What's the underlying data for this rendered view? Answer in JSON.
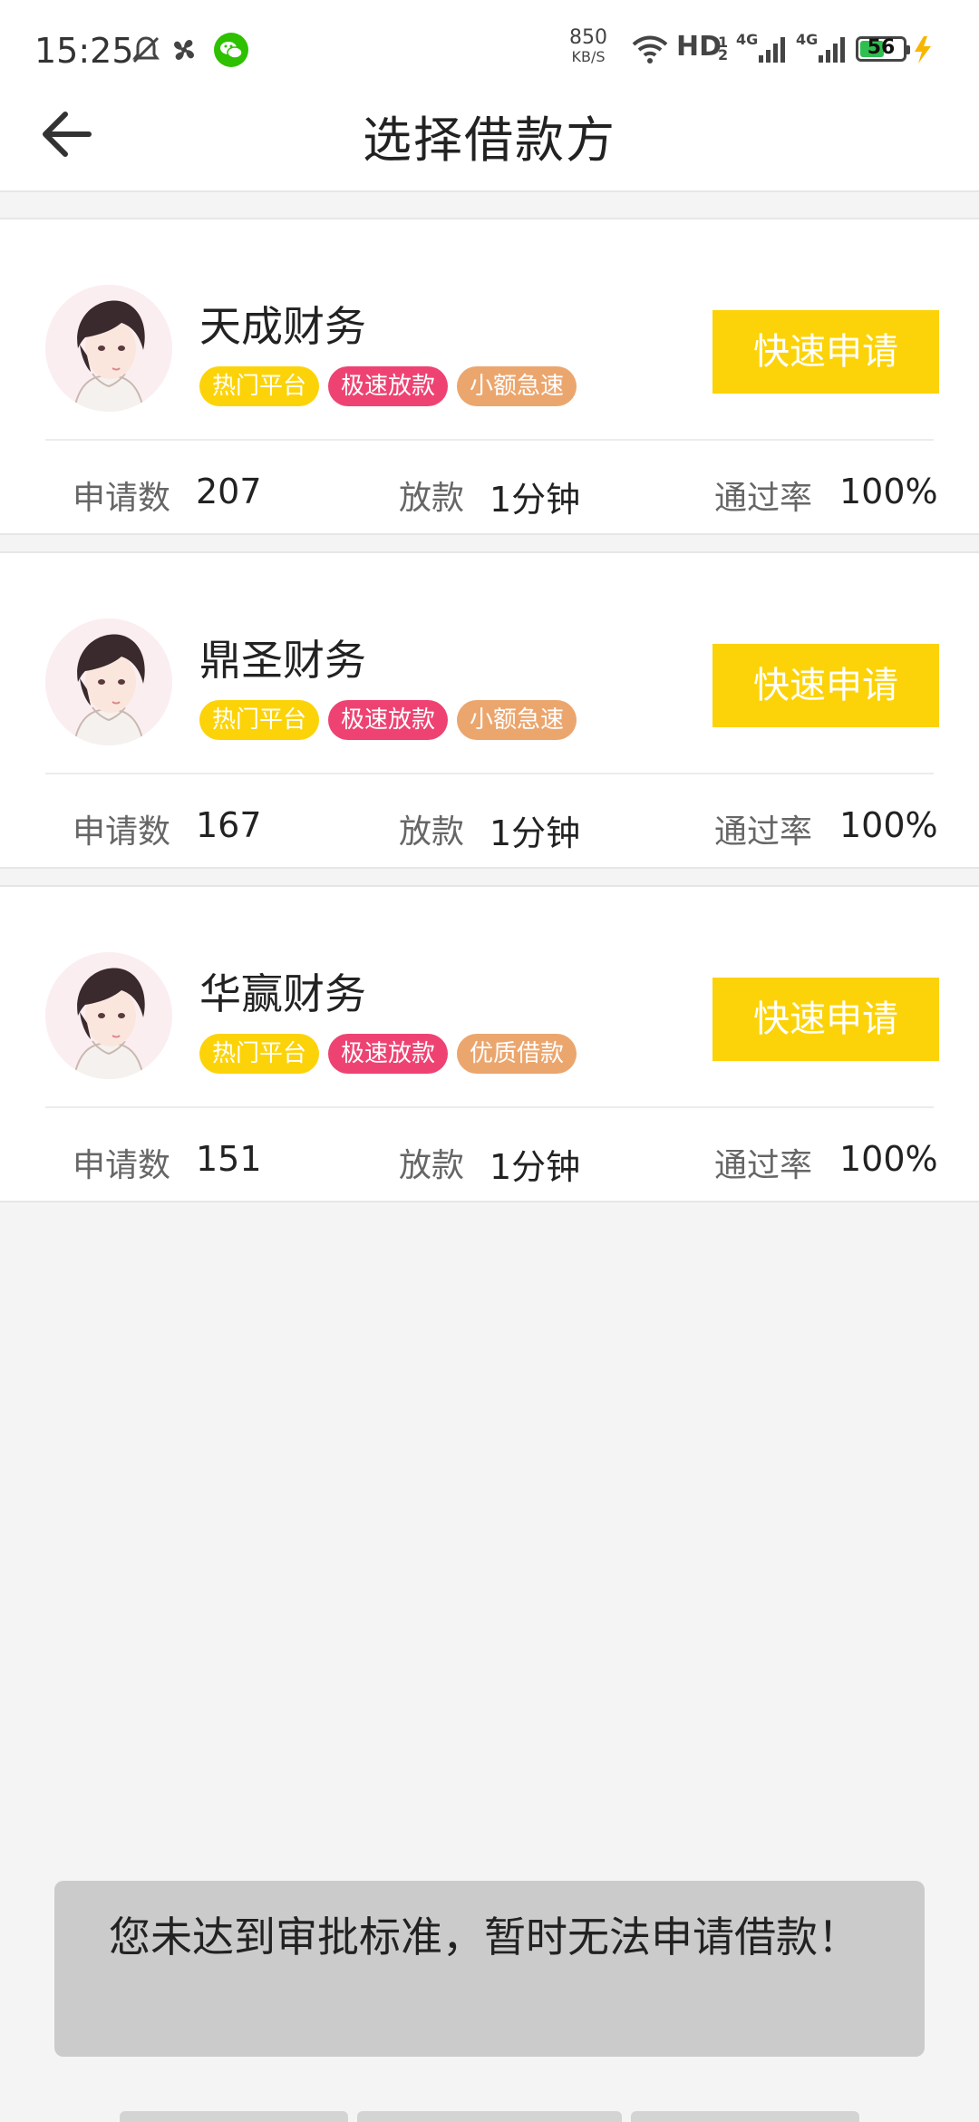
{
  "status_bar": {
    "time": "15:25",
    "net_speed_value": "850",
    "net_speed_unit": "KB/S",
    "hd_label": "HD",
    "hd_sub": "1 2",
    "signal1_label": "4G",
    "signal2_label": "4G",
    "battery_level": "56",
    "battery_fraction": 0.56,
    "icons": [
      "mute-bell-icon",
      "pinwheel-icon",
      "wechat-icon",
      "wifi-icon",
      "signal-icon",
      "signal-icon",
      "battery-icon",
      "charging-icon"
    ]
  },
  "header": {
    "back_icon": "back-arrow-icon",
    "title": "选择借款方"
  },
  "labels": {
    "apply_count": "申请数",
    "payout": "放款",
    "pass_rate": "通过率",
    "apply_button": "快速申请"
  },
  "lenders": [
    {
      "name": "天成财务",
      "tags": [
        "热门平台",
        "极速放款",
        "小额急速"
      ],
      "apply_count": "207",
      "payout_time": "1分钟",
      "pass_rate": "100%"
    },
    {
      "name": "鼎圣财务",
      "tags": [
        "热门平台",
        "极速放款",
        "小额急速"
      ],
      "apply_count": "167",
      "payout_time": "1分钟",
      "pass_rate": "100%"
    },
    {
      "name": "华赢财务",
      "tags": [
        "热门平台",
        "极速放款",
        "优质借款"
      ],
      "apply_count": "151",
      "payout_time": "1分钟",
      "pass_rate": "100%"
    }
  ],
  "toast": {
    "message": "您未达到审批标准，暂时无法申请借款！"
  },
  "colors": {
    "apply_button": "#fcd308",
    "tag_hot": "#fcd308",
    "tag_fast": "#ee4372",
    "tag_small": "#eba66e",
    "background": "#f4f4f4",
    "toast_background": "#cbcbcb"
  }
}
